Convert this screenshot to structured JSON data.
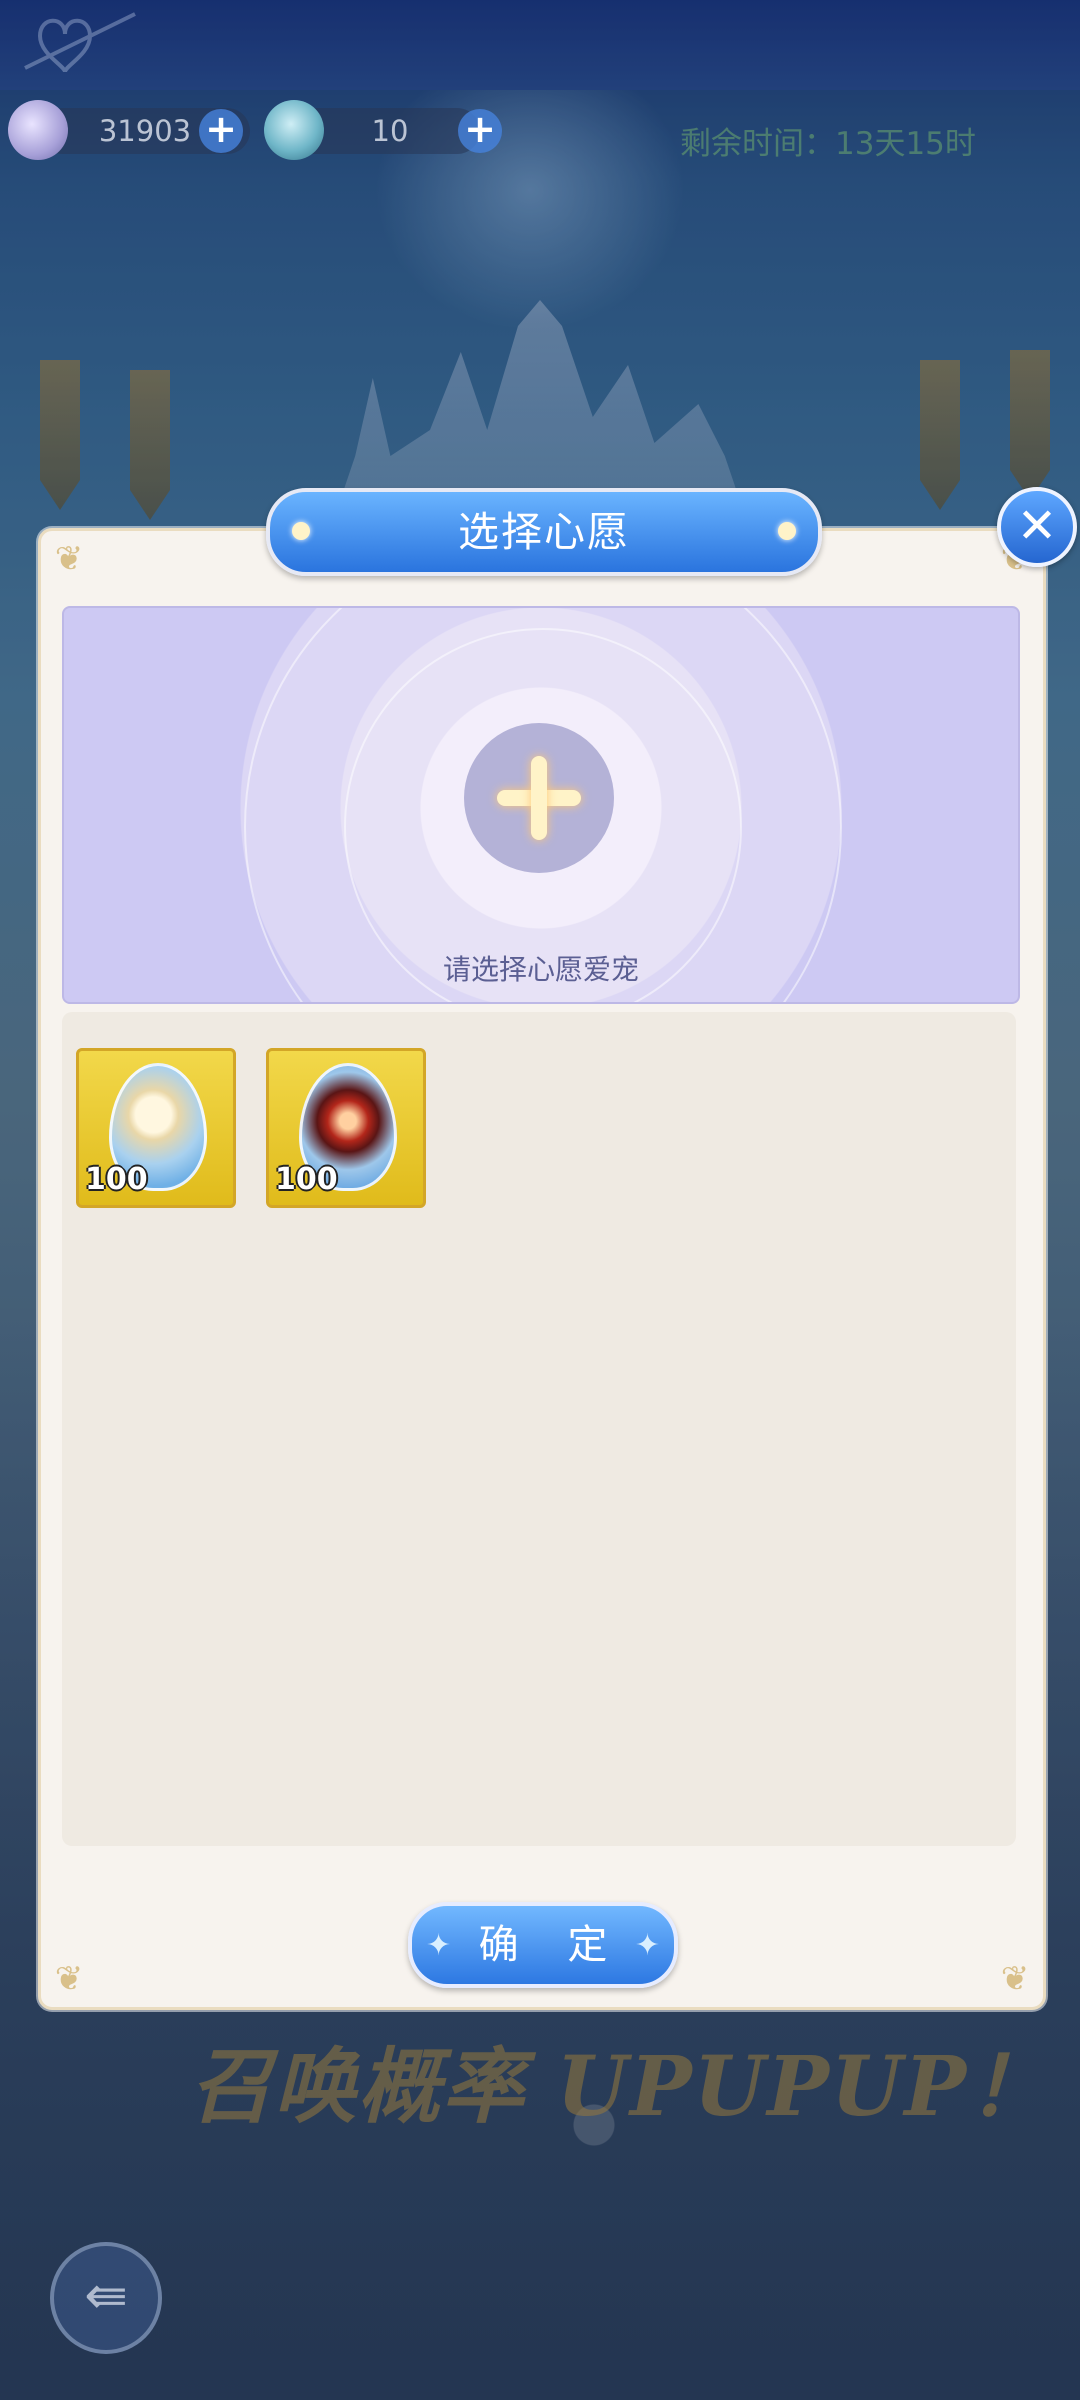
{
  "resources": [
    {
      "icon": "crystal-feather-icon",
      "value": "31903"
    },
    {
      "icon": "summon-coin-icon",
      "value": "10"
    }
  ],
  "timer": {
    "text": "剩余时间：13天15时"
  },
  "dialog": {
    "title": "选择心愿",
    "wish_hint": "请选择心愿爱宠",
    "items": [
      {
        "icon": "pet-egg-icon",
        "count": "100"
      },
      {
        "icon": "pet-egg-icon",
        "count": "100"
      }
    ],
    "confirm_label": "确 定"
  },
  "promo": {
    "text": "召唤概率 UPUPUP！"
  }
}
